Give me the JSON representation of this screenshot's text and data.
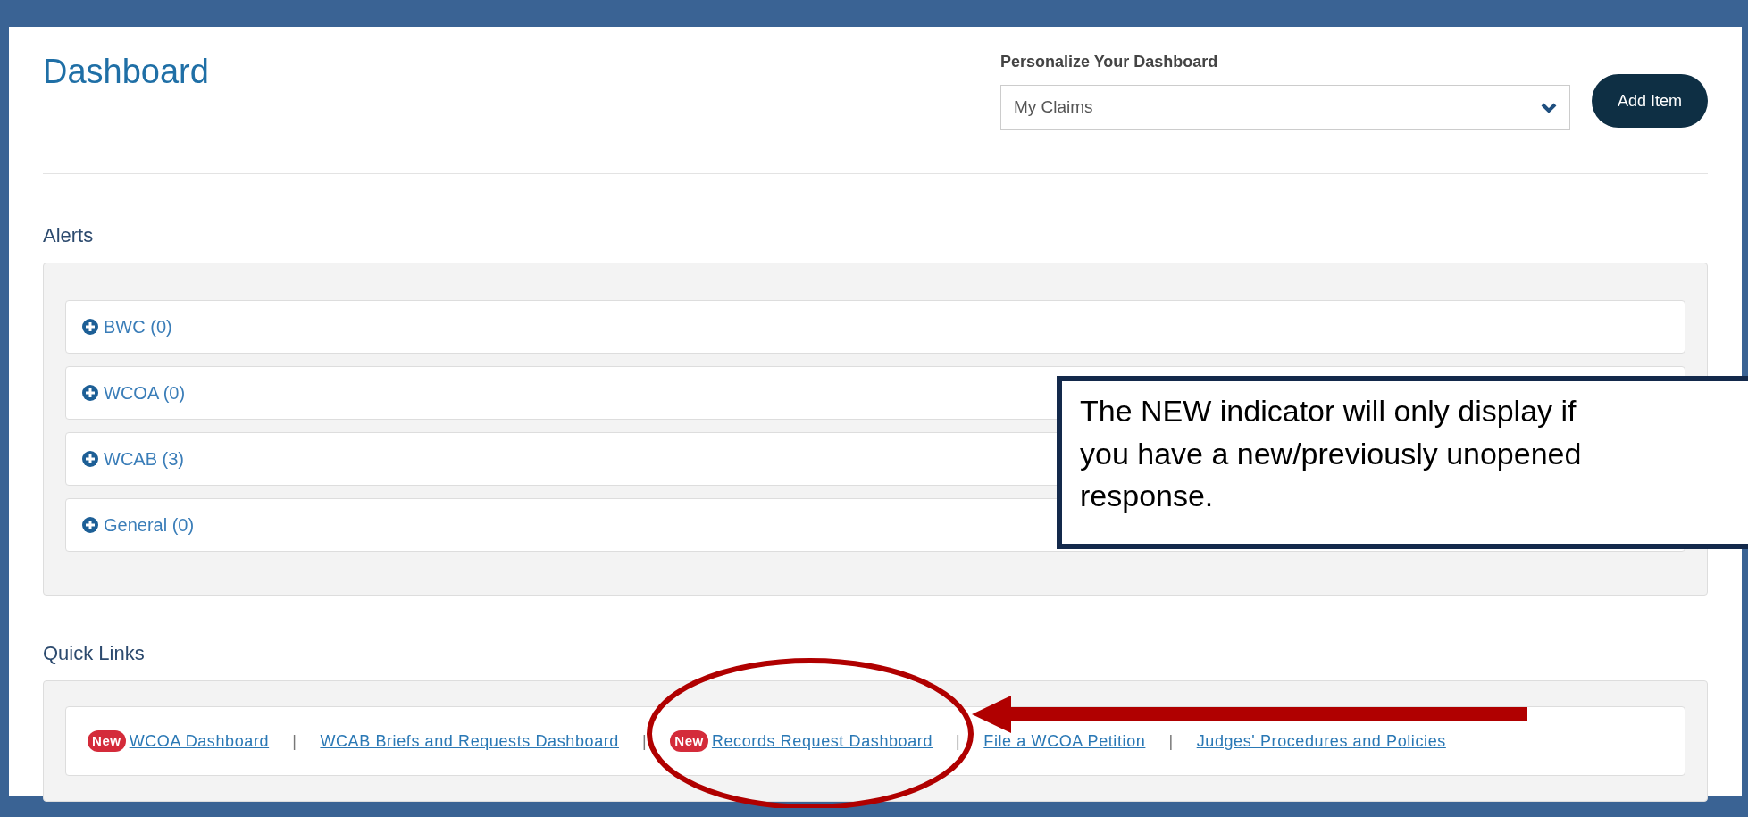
{
  "header": {
    "title": "Dashboard",
    "personalize_label": "Personalize Your Dashboard",
    "select_value": "My Claims",
    "add_button": "Add Item"
  },
  "alerts": {
    "heading": "Alerts",
    "items": [
      {
        "label": "BWC (0)",
        "expanded": false
      },
      {
        "label": "WCOA (0)",
        "expanded": false
      },
      {
        "label": "WCAB (3)",
        "expanded": false
      },
      {
        "label": "General (0)",
        "expanded": false
      }
    ]
  },
  "quick_links": {
    "heading": "Quick Links",
    "links": [
      {
        "label": "WCOA Dashboard",
        "badge": "New"
      },
      {
        "separator": "|",
        "label": "WCAB Briefs and Requests Dashboard"
      },
      {
        "separator": "|",
        "label": "Records Request Dashboard",
        "badge": "New"
      },
      {
        "separator": "|",
        "label": "File a WCOA Petition"
      },
      {
        "separator": "|",
        "label": "Judges' Procedures and Policies"
      }
    ]
  },
  "callout": {
    "text": "The NEW indicator will only display if you have a new/previously unopened response."
  }
}
